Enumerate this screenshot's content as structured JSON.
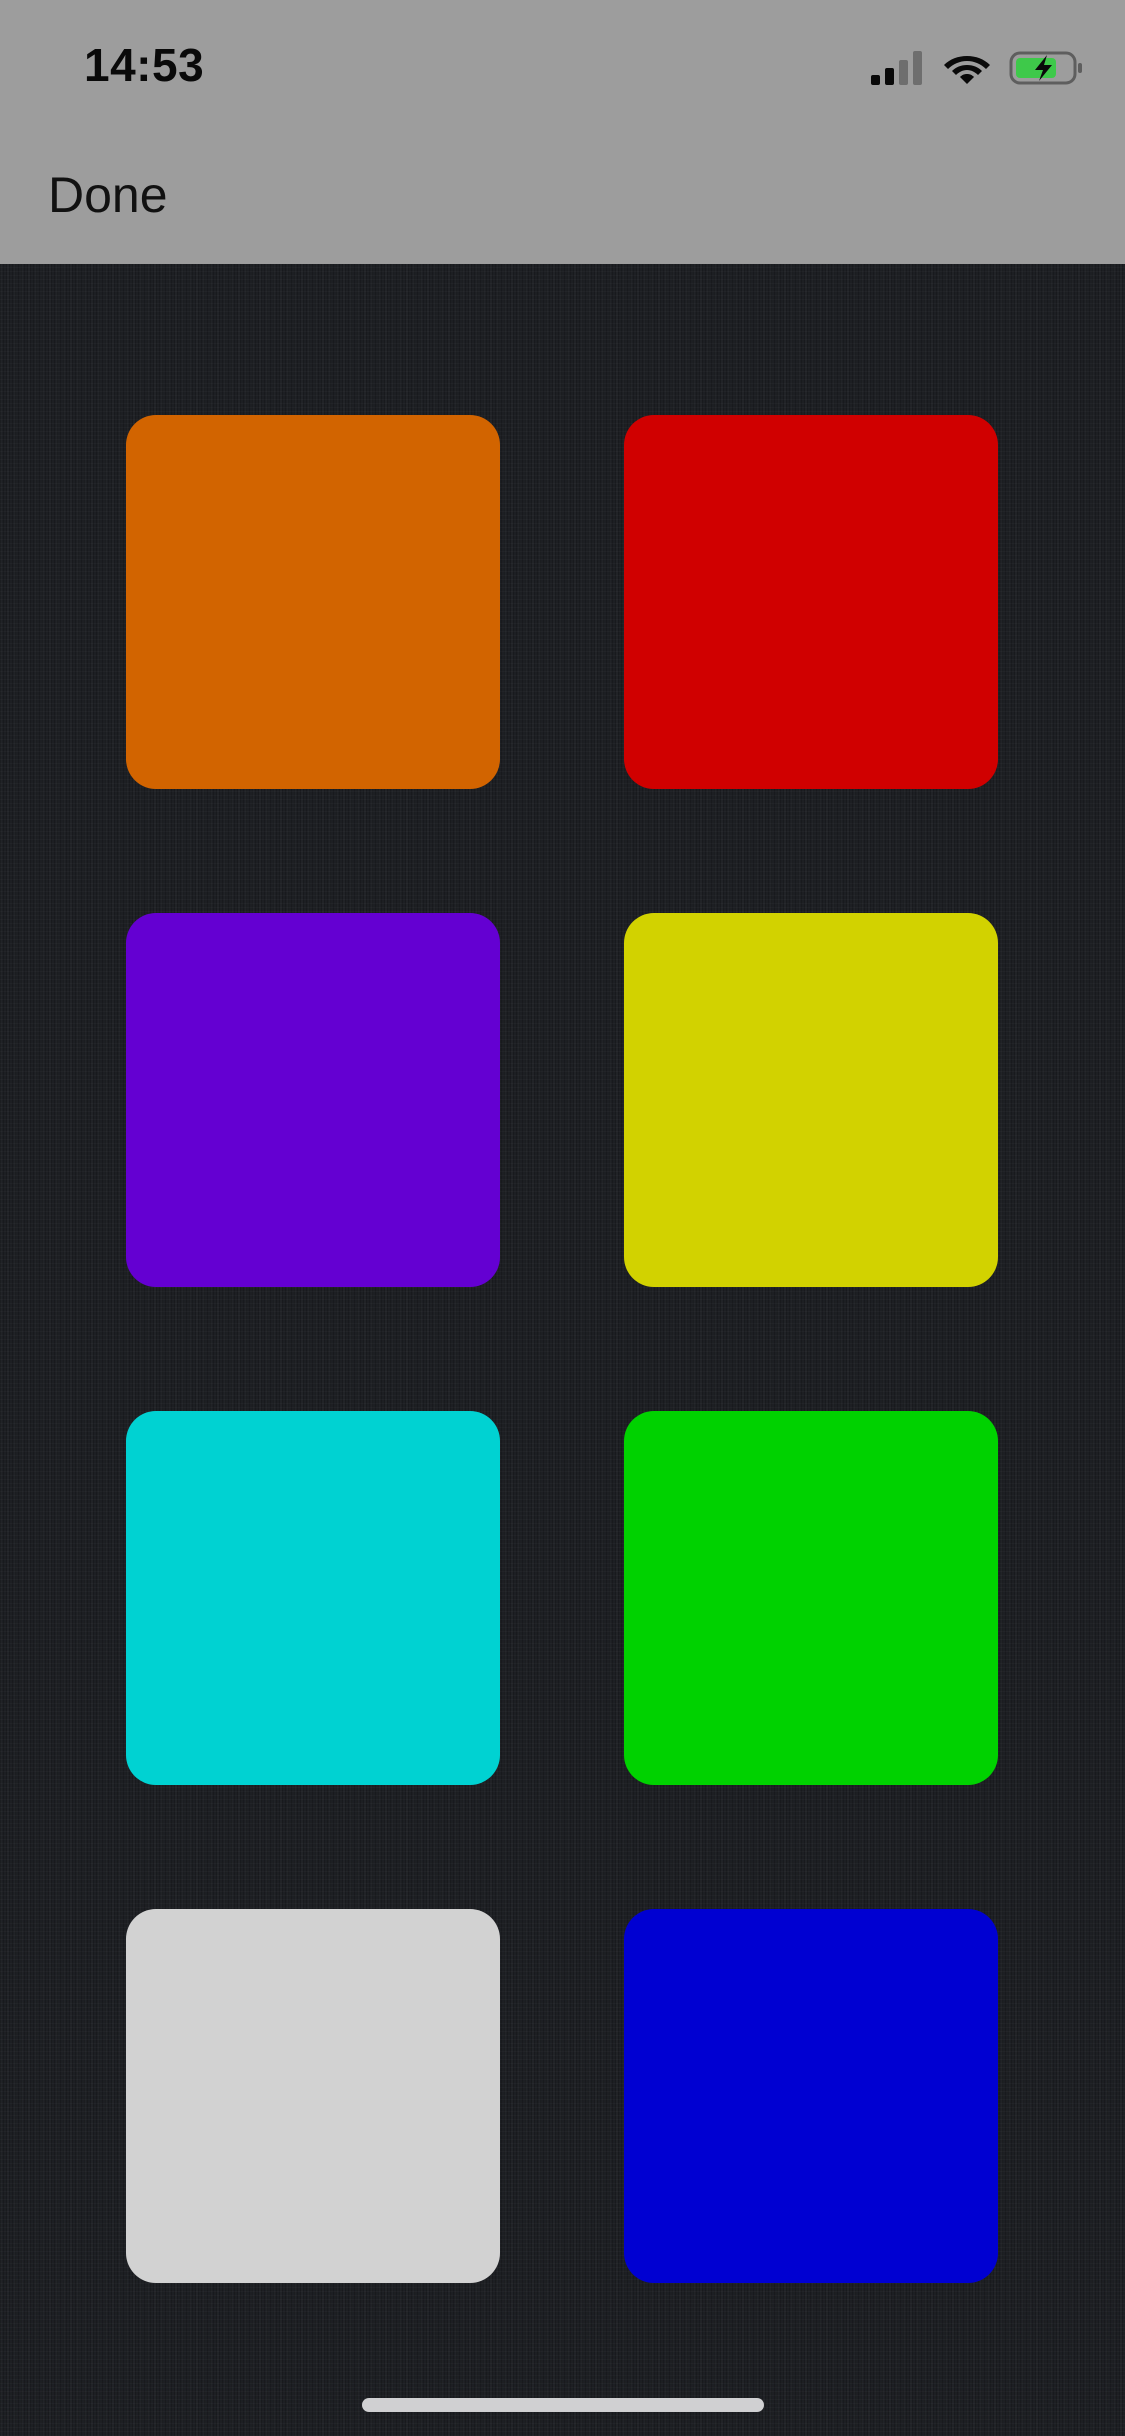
{
  "status_bar": {
    "time": "14:53",
    "icons": [
      "cellular-signal-icon",
      "wifi-icon",
      "battery-charging-icon"
    ],
    "battery_color": "#3ec94a"
  },
  "nav": {
    "done_label": "Done"
  },
  "swatches": [
    {
      "color": "#d26400"
    },
    {
      "color": "#d00000"
    },
    {
      "color": "#6400d2"
    },
    {
      "color": "#d2d200"
    },
    {
      "color": "#00d2d2"
    },
    {
      "color": "#00d200"
    },
    {
      "color": "#d2d2d2"
    },
    {
      "color": "#0000d2"
    }
  ],
  "colors": {
    "header_bg": "#9d9d9d",
    "content_bg": "#1d1f23",
    "home_indicator": "#d0d0d2"
  }
}
